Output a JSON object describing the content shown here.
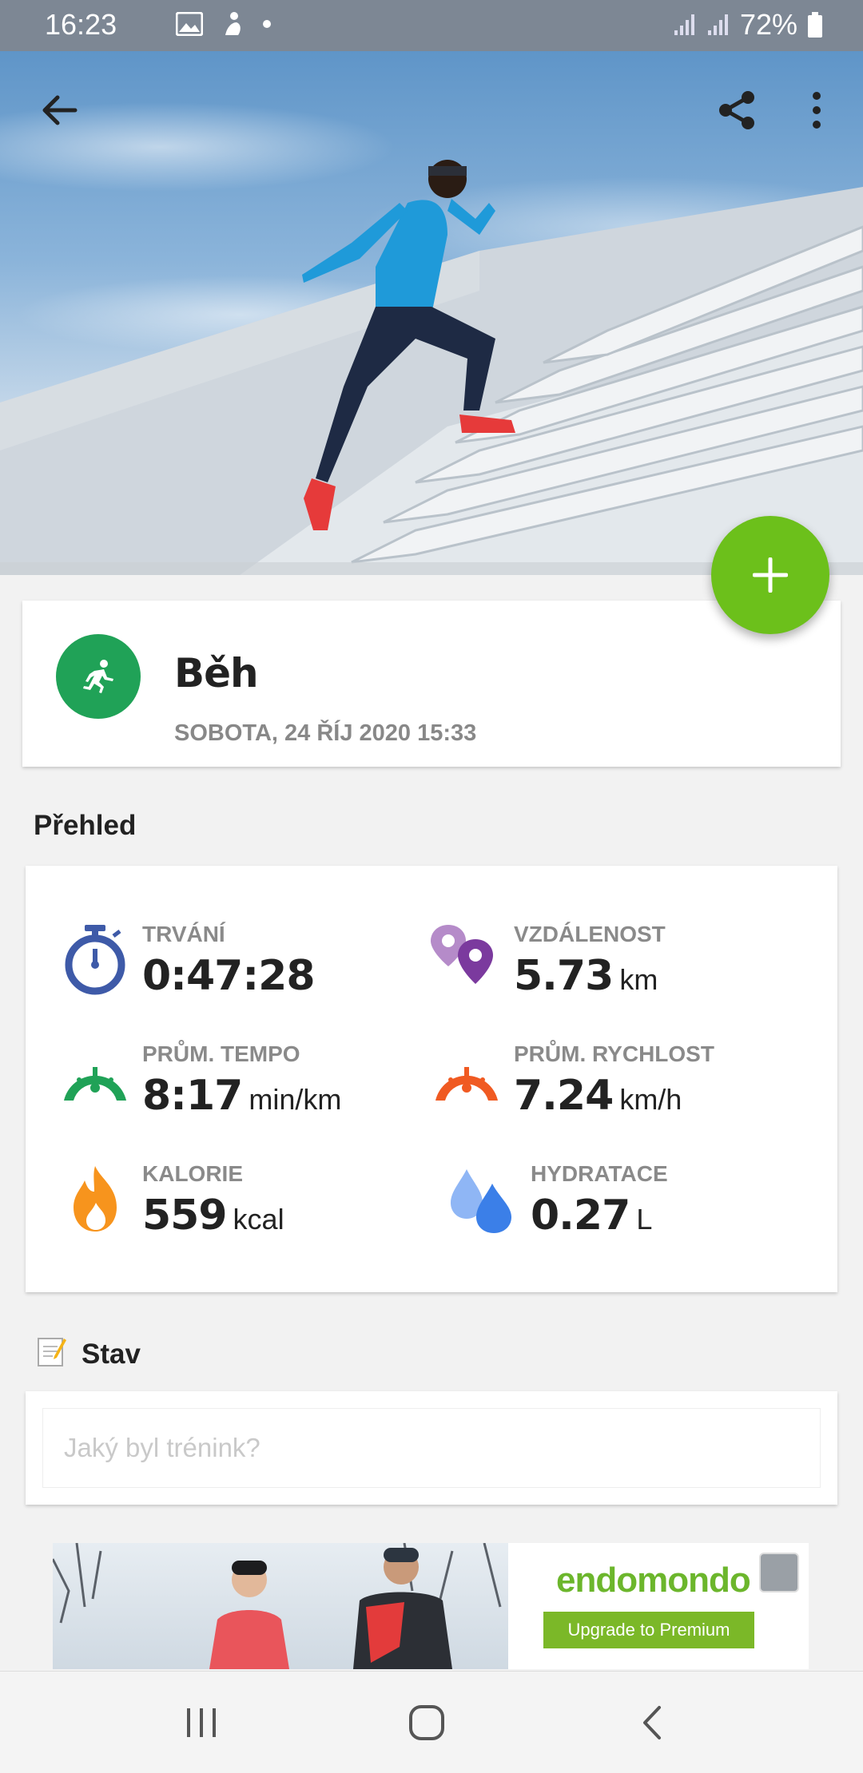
{
  "status_bar": {
    "time": "16:23",
    "battery": "72%"
  },
  "toolbar": {
    "back_icon": "arrow-left-icon",
    "share_icon": "share-icon",
    "more_icon": "more-vert-icon"
  },
  "fab": {
    "icon": "plus-icon",
    "color": "#6cc01b"
  },
  "activity": {
    "title": "Běh",
    "date": "SOBOTA, 24 ŘÍJ 2020 15:33",
    "icon": "running-icon",
    "color": "#20a257"
  },
  "overview": {
    "title": "Přehled",
    "stats": [
      {
        "label": "TRVÁNÍ",
        "value": "0:47:28",
        "unit": "",
        "icon": "stopwatch-icon"
      },
      {
        "label": "VZDÁLENOST",
        "value": "5.73",
        "unit": "km",
        "icon": "location-pins-icon"
      },
      {
        "label": "PRŮM. TEMPO",
        "value": "8:17",
        "unit": "min/km",
        "icon": "gauge-icon"
      },
      {
        "label": "PRŮM. RYCHLOST",
        "value": "7.24",
        "unit": "km/h",
        "icon": "speedometer-icon"
      },
      {
        "label": "KALORIE",
        "value": "559",
        "unit": "kcal",
        "icon": "flame-icon"
      },
      {
        "label": "HYDRATACE",
        "value": "0.27",
        "unit": "L",
        "icon": "water-drops-icon"
      }
    ]
  },
  "status_section": {
    "title": "Stav",
    "icon": "memo-icon",
    "placeholder": "Jaký byl trénink?"
  },
  "ad": {
    "brand": "endomondo",
    "button": "Upgrade to Premium"
  },
  "nav_bar": {
    "recents_icon": "recents-icon",
    "home_icon": "home-icon",
    "back_icon": "nav-back-icon"
  }
}
